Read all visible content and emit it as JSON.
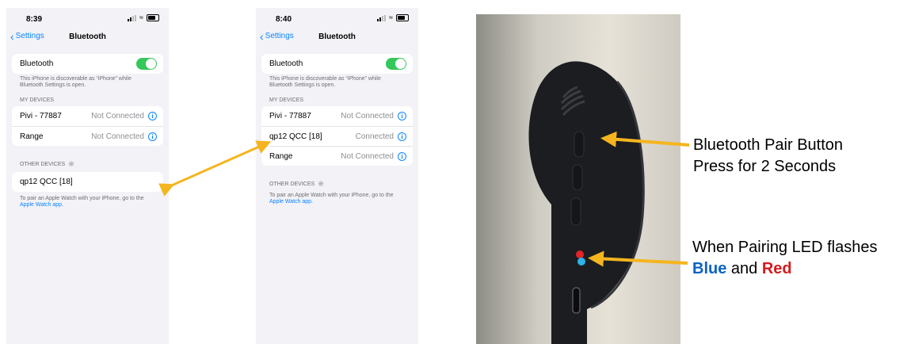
{
  "phone1": {
    "time": "8:39",
    "back_label": "Settings",
    "title": "Bluetooth",
    "bluetooth_label": "Bluetooth",
    "discoverable_note": "This iPhone is discoverable as “iPhone” while Bluetooth Settings is open.",
    "my_devices_header": "MY DEVICES",
    "my_devices": [
      {
        "name": "Pivi - 77887",
        "status": "Not Connected"
      },
      {
        "name": "Range",
        "status": "Not Connected"
      }
    ],
    "other_devices_header": "OTHER DEVICES",
    "other_devices": [
      {
        "name": "qp12 QCC [18]"
      }
    ],
    "watch_note": "To pair an Apple Watch with your iPhone, go to the",
    "watch_link": "Apple Watch app."
  },
  "phone2": {
    "time": "8:40",
    "back_label": "Settings",
    "title": "Bluetooth",
    "bluetooth_label": "Bluetooth",
    "discoverable_note": "This iPhone is discoverable as “iPhone” while Bluetooth Settings is open.",
    "my_devices_header": "MY DEVICES",
    "my_devices": [
      {
        "name": "Pivi - 77887",
        "status": "Not Connected"
      },
      {
        "name": "qp12 QCC [18]",
        "status": "Connected"
      },
      {
        "name": "Range",
        "status": "Not Connected"
      }
    ],
    "other_devices_header": "OTHER DEVICES",
    "watch_note": "To pair an Apple Watch with your iPhone, go to the",
    "watch_link": "Apple Watch app."
  },
  "annotations": {
    "pair_button_line1": "Bluetooth Pair Button",
    "pair_button_line2": "Press for 2 Seconds",
    "led_line1": "When Pairing LED flashes",
    "led_blue": "Blue",
    "led_and": " and ",
    "led_red": "Red"
  },
  "icons": {
    "info": "i",
    "back": "chevron-left-icon",
    "spinner": "spinner-icon",
    "toggle": "toggle-on-icon"
  },
  "colors": {
    "ios_blue": "#0a84ff",
    "toggle_green": "#34c759",
    "arrow_yellow": "#f5b51f",
    "led_blue_text": "#0b63c1",
    "led_red_text": "#d21c1c"
  }
}
